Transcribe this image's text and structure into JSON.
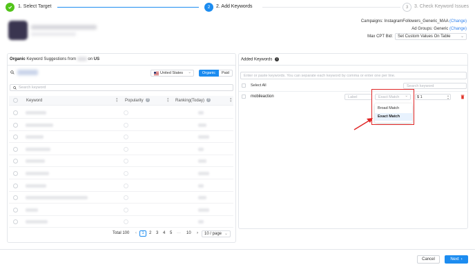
{
  "stepper": {
    "step1_label": "1. Select Target",
    "step2_number": "2",
    "step2_label": "2. Add Keywords",
    "step3_number": "3",
    "step3_label": "3. Check Keyword Issues"
  },
  "campaign_info": {
    "campaigns_label": "Campaigns: InstagramFollowers_Generic_MAA",
    "change1": "(Change)",
    "adgroups_label": "Ad Groups: Generic",
    "change2": "(Change)",
    "maxcpt_label": "Max CPT Bid:",
    "maxcpt_value": "Set Custom Values On Table"
  },
  "left_panel": {
    "title_bold": "Organic",
    "title_rest": "Keyword Suggestions from",
    "title_on": "on",
    "title_country": "US",
    "country_select": "United States",
    "toggle_organic": "Organic",
    "toggle_paid": "Paid",
    "search_placeholder": "Search keyword",
    "col_keyword": "Keyword",
    "col_popularity": "Popularity",
    "col_ranking": "Ranking(Today)",
    "rows": 10
  },
  "pagination": {
    "total": "Total 100",
    "prev": "‹",
    "p1": "1",
    "p2": "2",
    "p3": "3",
    "p4": "4",
    "p5": "5",
    "ellipsis": "···",
    "p10": "10",
    "next": "›",
    "per_page": "10 / page"
  },
  "right_panel": {
    "title": "Added Keywords",
    "enter_placeholder": "Enter or paste keywords. You can separate each keyword by comma or enter one per line.",
    "select_all": "Select All",
    "search_placeholder": "Search keyword",
    "keyword_row": {
      "keyword": "mobileaction",
      "label_placeholder": "Label",
      "match_value": "Exact Match",
      "bid_value": "$ 1"
    },
    "dropdown_options": [
      "Broad Match",
      "Exact Match"
    ]
  },
  "footer": {
    "cancel": "Cancel",
    "next": "Next"
  },
  "colors": {
    "primary": "#1c8cf0",
    "success": "#52c41a",
    "highlight": "#e02424",
    "delete": "#e0362c"
  }
}
